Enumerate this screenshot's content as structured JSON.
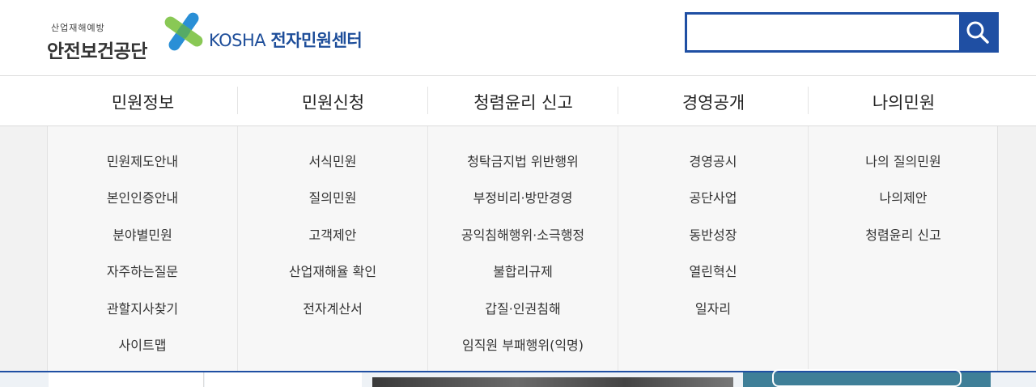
{
  "header": {
    "logo_small": "산업재해예방",
    "logo_main": "안전보건공단",
    "logo_brand": "KOSHA",
    "logo_service": "전자민원센터",
    "search_value": ""
  },
  "nav": [
    {
      "label": "민원정보"
    },
    {
      "label": "민원신청"
    },
    {
      "label": "청렴윤리 신고"
    },
    {
      "label": "경영공개"
    },
    {
      "label": "나의민원"
    }
  ],
  "menus": [
    [
      "민원제도안내",
      "본인인증안내",
      "분야별민원",
      "자주하는질문",
      "관할지사찾기",
      "사이트맵"
    ],
    [
      "서식민원",
      "질의민원",
      "고객제안",
      "산업재해율 확인",
      "전자계산서"
    ],
    [
      "청탁금지법 위반행위",
      "부정비리·방만경영",
      "공익침해행위·소극행정",
      "불합리규제",
      "갑질·인권침해",
      "임직원 부패행위(익명)"
    ],
    [
      "경영공시",
      "공단사업",
      "동반성장",
      "열린혁신",
      "일자리"
    ],
    [
      "나의 질의민원",
      "나의제안",
      "청렴윤리 신고"
    ]
  ],
  "colors": {
    "brand_blue": "#1f4fa3",
    "logo_blue": "#1e4e9a",
    "logo_cross_blue": "#2a8fd6",
    "logo_cross_green": "#7cc242",
    "teal_banner": "#3f7f98"
  }
}
